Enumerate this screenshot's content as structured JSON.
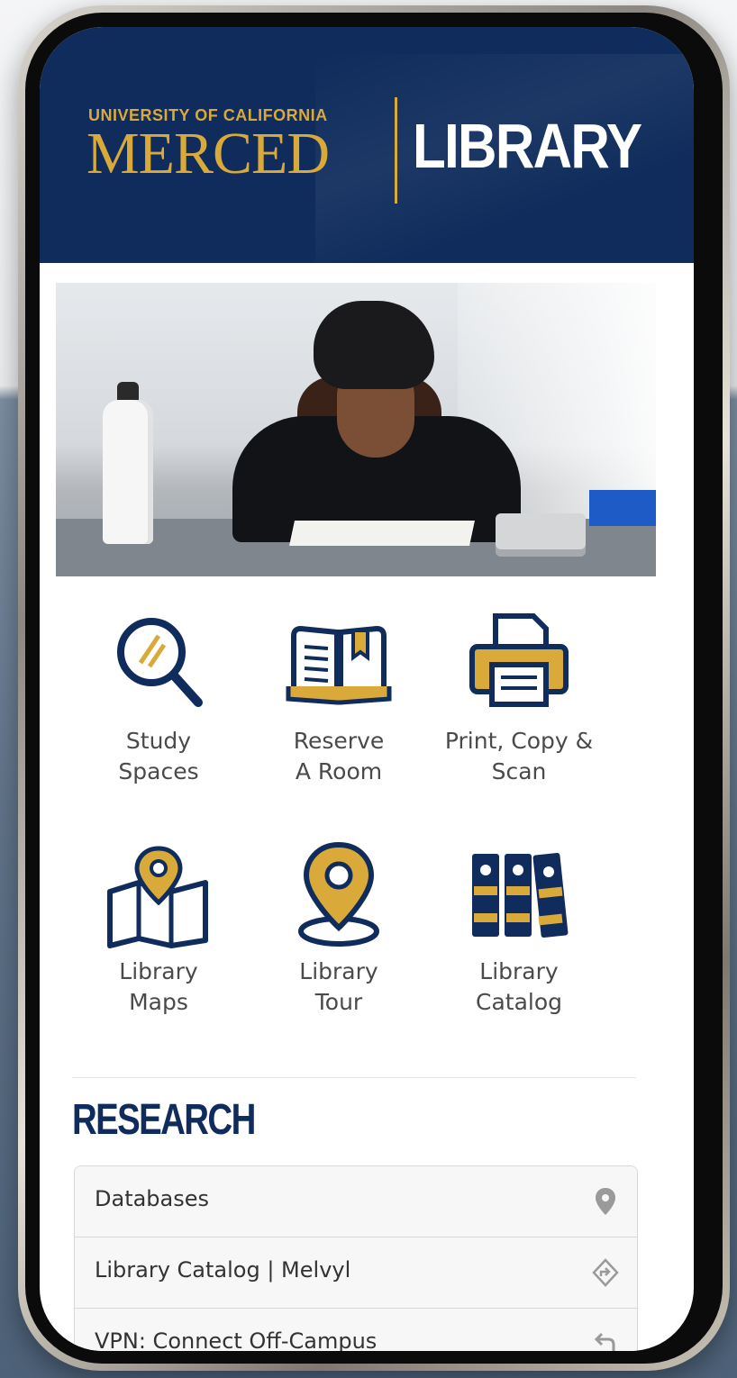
{
  "header": {
    "logo_top": "UNIVERSITY OF CALIFORNIA",
    "logo_main": "MERCED",
    "library_label": "LIBRARY"
  },
  "colors": {
    "navy": "#0f2c5c",
    "gold": "#d9a93a"
  },
  "tiles": [
    {
      "label": "Study\nSpaces",
      "icon": "magnifier-icon"
    },
    {
      "label": "Reserve\nA Room",
      "icon": "book-bookmark-icon"
    },
    {
      "label": "Print, Copy &\nScan",
      "icon": "printer-icon"
    },
    {
      "label": "Library\nMaps",
      "icon": "map-pin-icon"
    },
    {
      "label": "Library\nTour",
      "icon": "location-pin-icon"
    },
    {
      "label": "Library\nCatalog",
      "icon": "books-icon"
    }
  ],
  "research": {
    "title": "RESEARCH",
    "items": [
      {
        "label": "Databases",
        "icon": "map-marker-icon"
      },
      {
        "label": "Library Catalog | Melvyl",
        "icon": "directions-icon"
      },
      {
        "label": "VPN: Connect Off-Campus",
        "icon": "return-arrow-icon"
      }
    ]
  }
}
